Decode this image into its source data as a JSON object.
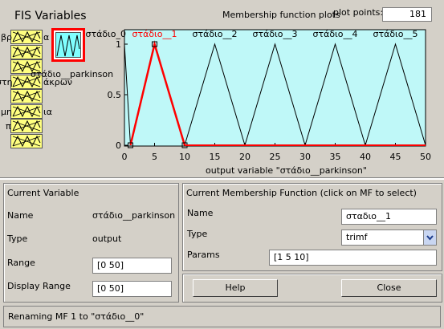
{
  "fis_variables_title": "FIS Variables",
  "input_variables": [
    {
      "label": "βρ",
      "label2": "α"
    },
    {
      "label": ""
    },
    {
      "label": ""
    },
    {
      "label": "στη",
      "label2": "άκρων"
    },
    {
      "label": ""
    },
    {
      "label": "μη",
      "label2": "ια"
    },
    {
      "label": "π"
    },
    {
      "label": ""
    }
  ],
  "output_variable_label": "στάδιο__parkinson",
  "plot": {
    "title": "Membership function plots",
    "points_label": "plot points:",
    "points_value": "181",
    "xlabel": "output variable \"στάδιο__parkinson\"",
    "mf_labels": [
      "στάδιο_0",
      "στάδιο__1",
      "στάδιο__2",
      "στάδιο__3",
      "στάδιο__4",
      "στάδιο__5"
    ],
    "x_ticks": [
      "0",
      "5",
      "10",
      "15",
      "20",
      "25",
      "30",
      "35",
      "40",
      "45",
      "50"
    ],
    "y_ticks": [
      "0",
      "0.5",
      "1"
    ]
  },
  "chart_data": {
    "type": "line",
    "xlim": [
      0,
      50
    ],
    "ylim": [
      0,
      1
    ],
    "xlabel": "output variable \"στάδιο__parkinson\"",
    "series": [
      {
        "name": "στάδιο_0",
        "x": [
          0,
          0,
          1
        ],
        "y": [
          0,
          1,
          0
        ]
      },
      {
        "name": "στάδιο__1",
        "x": [
          1,
          5,
          10
        ],
        "y": [
          0,
          1,
          0
        ],
        "selected": true
      },
      {
        "name": "στάδιο__2",
        "x": [
          10,
          15,
          20
        ],
        "y": [
          0,
          1,
          0
        ]
      },
      {
        "name": "στάδιο__3",
        "x": [
          20,
          25,
          30
        ],
        "y": [
          0,
          1,
          0
        ]
      },
      {
        "name": "στάδιο__4",
        "x": [
          30,
          35,
          40
        ],
        "y": [
          0,
          1,
          0
        ]
      },
      {
        "name": "στάδιο__5",
        "x": [
          40,
          45,
          50
        ],
        "y": [
          0,
          1,
          0
        ]
      }
    ],
    "colors": {
      "normal": "#000000",
      "selected": "#ff0000",
      "background": "#bff8f8"
    }
  },
  "current_variable": {
    "title": "Current Variable",
    "name_label": "Name",
    "name_value": "στάδιο__parkinson",
    "type_label": "Type",
    "type_value": "output",
    "range_label": "Range",
    "range_value": "[0 50]",
    "display_range_label": "Display Range",
    "display_range_value": "[0 50]"
  },
  "current_mf": {
    "title": "Current Membership Function (click on MF to select)",
    "name_label": "Name",
    "name_value": "σταδιο__1",
    "type_label": "Type",
    "type_value": "trimf",
    "params_label": "Params",
    "params_value": "[1 5 10]"
  },
  "buttons": {
    "help": "Help",
    "close": "Close"
  },
  "status": "Renaming MF 1 to \"στάδιο__0\""
}
